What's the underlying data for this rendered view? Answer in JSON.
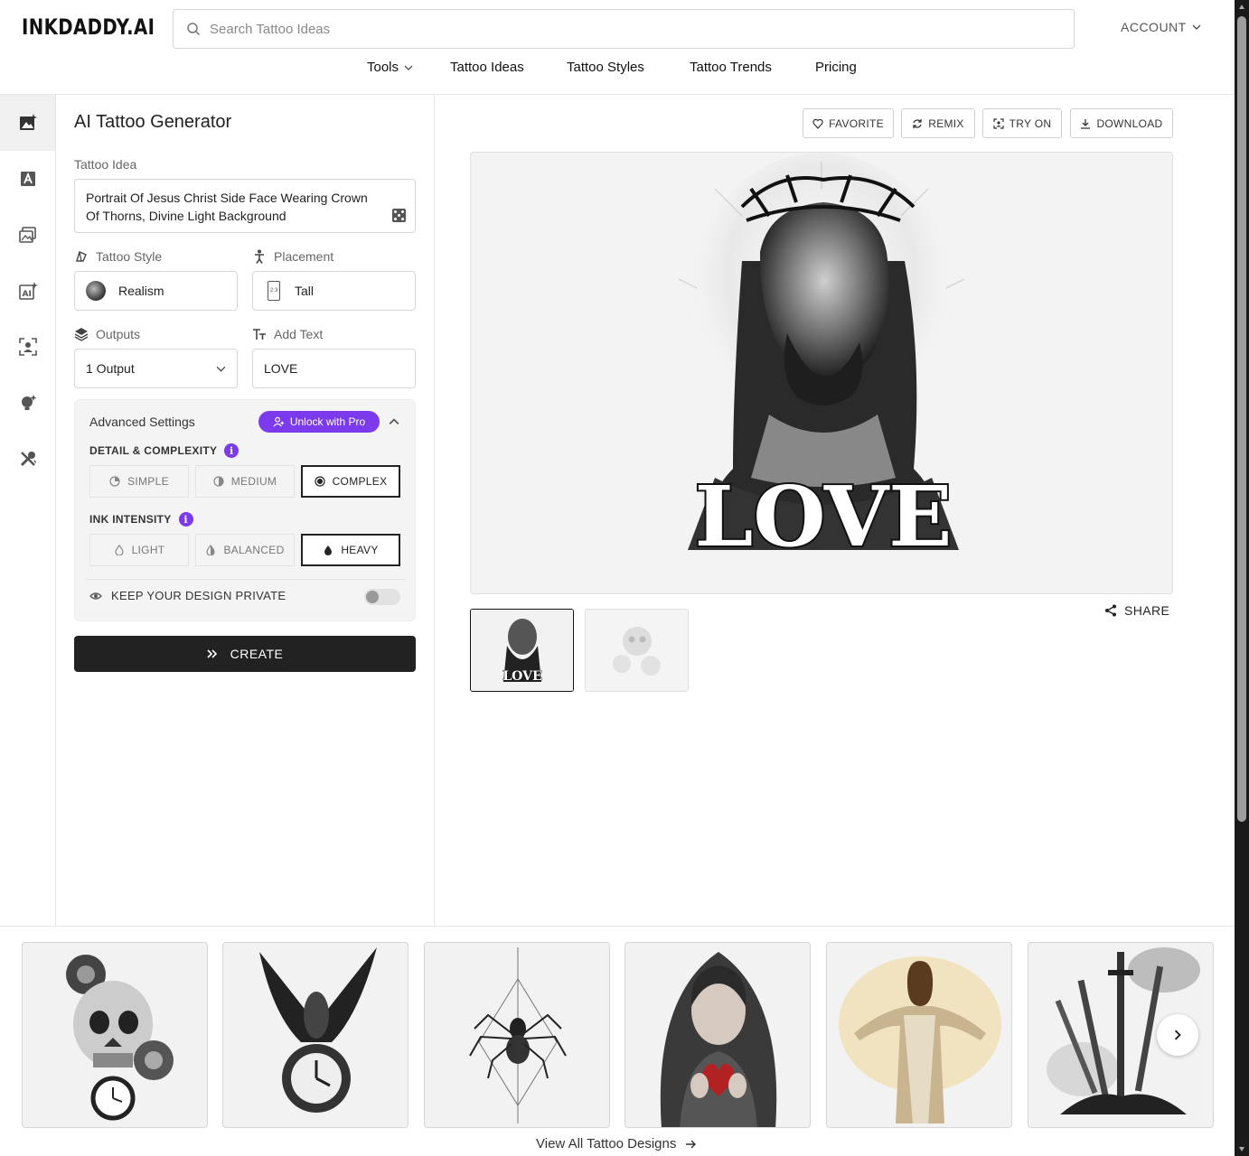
{
  "header": {
    "logo": "INKDADDY.AI",
    "search_placeholder": "Search Tattoo Ideas",
    "account_label": "ACCOUNT"
  },
  "nav": {
    "tools": "Tools",
    "tattoo_ideas": "Tattoo Ideas",
    "tattoo_styles": "Tattoo Styles",
    "tattoo_trends": "Tattoo Trends",
    "pricing": "Pricing"
  },
  "rail": {
    "items": [
      "image-generator-icon",
      "text-tattoo-icon",
      "gallery-icon",
      "ai-sparkle-icon",
      "try-on-icon",
      "idea-icon",
      "tools-icon"
    ]
  },
  "form": {
    "title": "AI Tattoo Generator",
    "idea_label": "Tattoo Idea",
    "idea_value": "Portrait Of Jesus Christ Side Face Wearing Crown Of Thorns, Divine Light Background",
    "style_label": "Tattoo Style",
    "style_value": "Realism",
    "placement_label": "Placement",
    "placement_value": "Tall",
    "outputs_label": "Outputs",
    "outputs_value": "1 Output",
    "add_text_label": "Add Text",
    "add_text_value": "LOVE",
    "advanced": {
      "title": "Advanced Settings",
      "unlock_label": "Unlock with Pro",
      "detail_label": "DETAIL & COMPLEXITY",
      "detail_options": [
        "SIMPLE",
        "MEDIUM",
        "COMPLEX"
      ],
      "detail_selected": "COMPLEX",
      "ink_label": "INK INTENSITY",
      "ink_options": [
        "LIGHT",
        "BALANCED",
        "HEAVY"
      ],
      "ink_selected": "HEAVY",
      "private_label": "KEEP YOUR DESIGN PRIVATE",
      "private_on": false
    },
    "create_label": "CREATE"
  },
  "result": {
    "actions": {
      "favorite": "FAVORITE",
      "remix": "REMIX",
      "try_on": "TRY ON",
      "download": "DOWNLOAD"
    },
    "image_text": "LOVE",
    "share_label": "SHARE",
    "thumb_text": "LOVE"
  },
  "gallery": {
    "items": [
      "skull-roses-clock",
      "eagle-clock",
      "geometric-spider",
      "woman-holding-heart",
      "jesus-open-arms",
      "swords-in-ground"
    ],
    "view_all_label": "View All Tattoo Designs"
  },
  "colors": {
    "accent_purple": "#7c3aed",
    "create_bg": "#222222"
  }
}
